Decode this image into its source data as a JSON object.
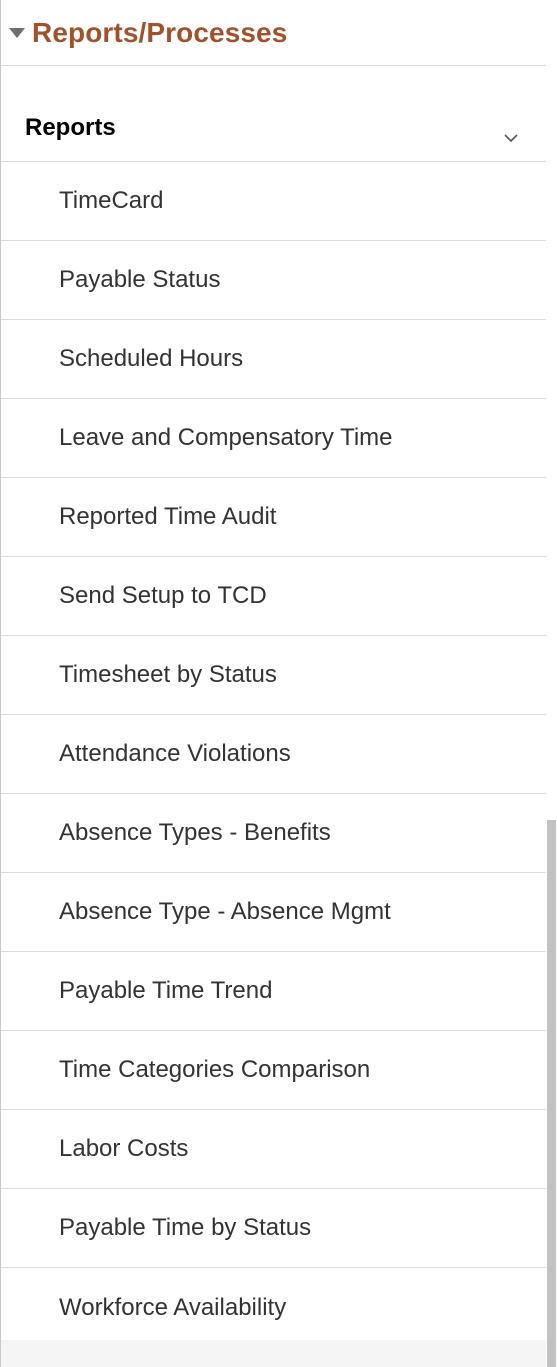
{
  "section": {
    "title": "Reports/Processes",
    "collapse_icon": "triangle-down-icon",
    "title_color": "#a0522d"
  },
  "group": {
    "title": "Reports",
    "toggle_icon": "chevron-down-icon"
  },
  "reports": [
    "TimeCard",
    "Payable Status",
    "Scheduled Hours",
    "Leave and Compensatory Time",
    "Reported Time Audit",
    "Send Setup to TCD",
    "Timesheet by Status",
    "Attendance Violations",
    "Absence Types - Benefits",
    "Absence Type - Absence Mgmt",
    "Payable Time Trend",
    "Time Categories Comparison",
    "Labor Costs",
    "Payable Time by Status",
    "Workforce Availability"
  ]
}
